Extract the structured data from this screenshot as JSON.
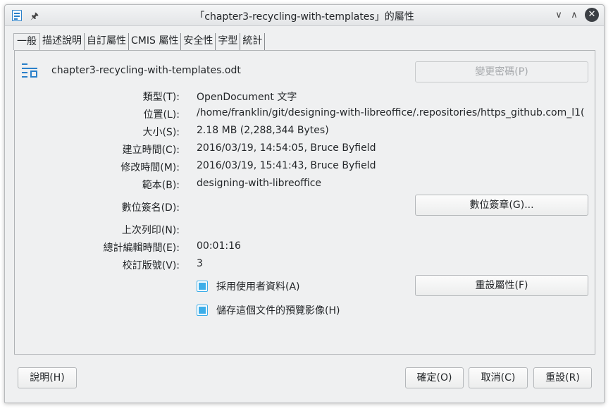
{
  "window": {
    "title": "「chapter3-recycling-with-templates」的屬性",
    "buttons": {
      "minimize": "∨",
      "maximize": "∧",
      "close": "✕"
    }
  },
  "tabs": [
    {
      "label": "一般"
    },
    {
      "label": "描述說明"
    },
    {
      "label": "自訂屬性"
    },
    {
      "label": "CMIS 屬性"
    },
    {
      "label": "安全性"
    },
    {
      "label": "字型"
    },
    {
      "label": "統計"
    }
  ],
  "general": {
    "filename": "chapter3-recycling-with-templates.odt",
    "change_password_button": "變更密碼(P)",
    "fields": {
      "type": {
        "label": "類型(T):",
        "value": "OpenDocument 文字"
      },
      "location": {
        "label": "位置(L):",
        "value": "/home/franklin/git/designing-with-libreoffice/.repositories/https_github.com_l1("
      },
      "size": {
        "label": "大小(S):",
        "value": "2.18 MB (2,288,344 Bytes)"
      },
      "created": {
        "label": "建立時間(C):",
        "value": "2016/03/19, 14:54:05, Bruce Byfield"
      },
      "modified": {
        "label": "修改時間(M):",
        "value": "2016/03/19, 15:41:43, Bruce Byfield"
      },
      "template": {
        "label": "範本(B):",
        "value": "designing-with-libreoffice"
      },
      "signature": {
        "label": "數位簽名(D):",
        "value": ""
      },
      "printed": {
        "label": "上次列印(N):",
        "value": ""
      },
      "editing_time": {
        "label": "總計編輯時間(E):",
        "value": "00:01:16"
      },
      "revision": {
        "label": "校訂版號(V):",
        "value": "3"
      }
    },
    "digital_signature_button": "數位簽章(G)...",
    "use_user_data_label": "採用使用者資料(A)",
    "use_user_data_checked": true,
    "reset_properties_button": "重設屬性(F)",
    "save_preview_label": "儲存這個文件的預覽影像(H)",
    "save_preview_checked": true
  },
  "footer": {
    "help": "說明(H)",
    "ok": "確定(O)",
    "cancel": "取消(C)",
    "reset": "重設(R)"
  },
  "colors": {
    "accent": "#3daee9",
    "icon_blue": "#2a80c9",
    "window_bg": "#eff0f1"
  }
}
